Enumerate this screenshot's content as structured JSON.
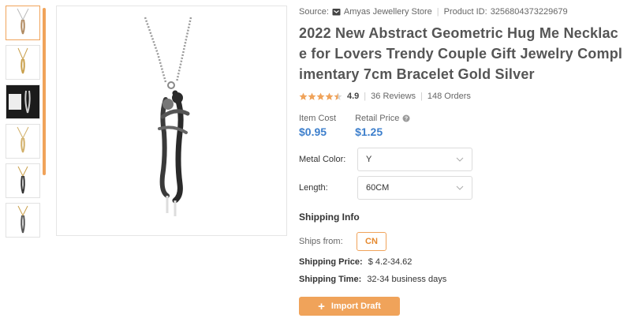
{
  "source": {
    "label": "Source:",
    "store_icon": "store-icon",
    "store_name": "Amyas Jewellery Store",
    "product_id_label": "Product ID:",
    "product_id": "3256804373229679"
  },
  "product": {
    "title": "2022 New Abstract Geometric Hug Me Necklace for Lovers Trendy Couple Gift Jewelry Complimentary 7cm Bracelet Gold Silver",
    "rating": "4.9",
    "rating_stars": 4.5,
    "reviews": "36 Reviews",
    "orders": "148 Orders"
  },
  "pricing": {
    "item_cost_label": "Item Cost",
    "item_cost": "$0.95",
    "retail_price_label": "Retail Price",
    "retail_price": "$1.25"
  },
  "options": {
    "metal_color_label": "Metal Color:",
    "metal_color_value": "Y",
    "length_label": "Length:",
    "length_value": "60CM"
  },
  "shipping": {
    "title": "Shipping Info",
    "ships_from_label": "Ships from:",
    "ships_from_value": "CN",
    "price_label": "Shipping Price:",
    "price_value": "$ 4.2-34.62",
    "time_label": "Shipping Time:",
    "time_value": "32-34 business days"
  },
  "actions": {
    "import_label": "Import Draft"
  },
  "colors": {
    "accent": "#f0a35a",
    "price_blue": "#3d7fcc",
    "star": "#f0a35a"
  }
}
